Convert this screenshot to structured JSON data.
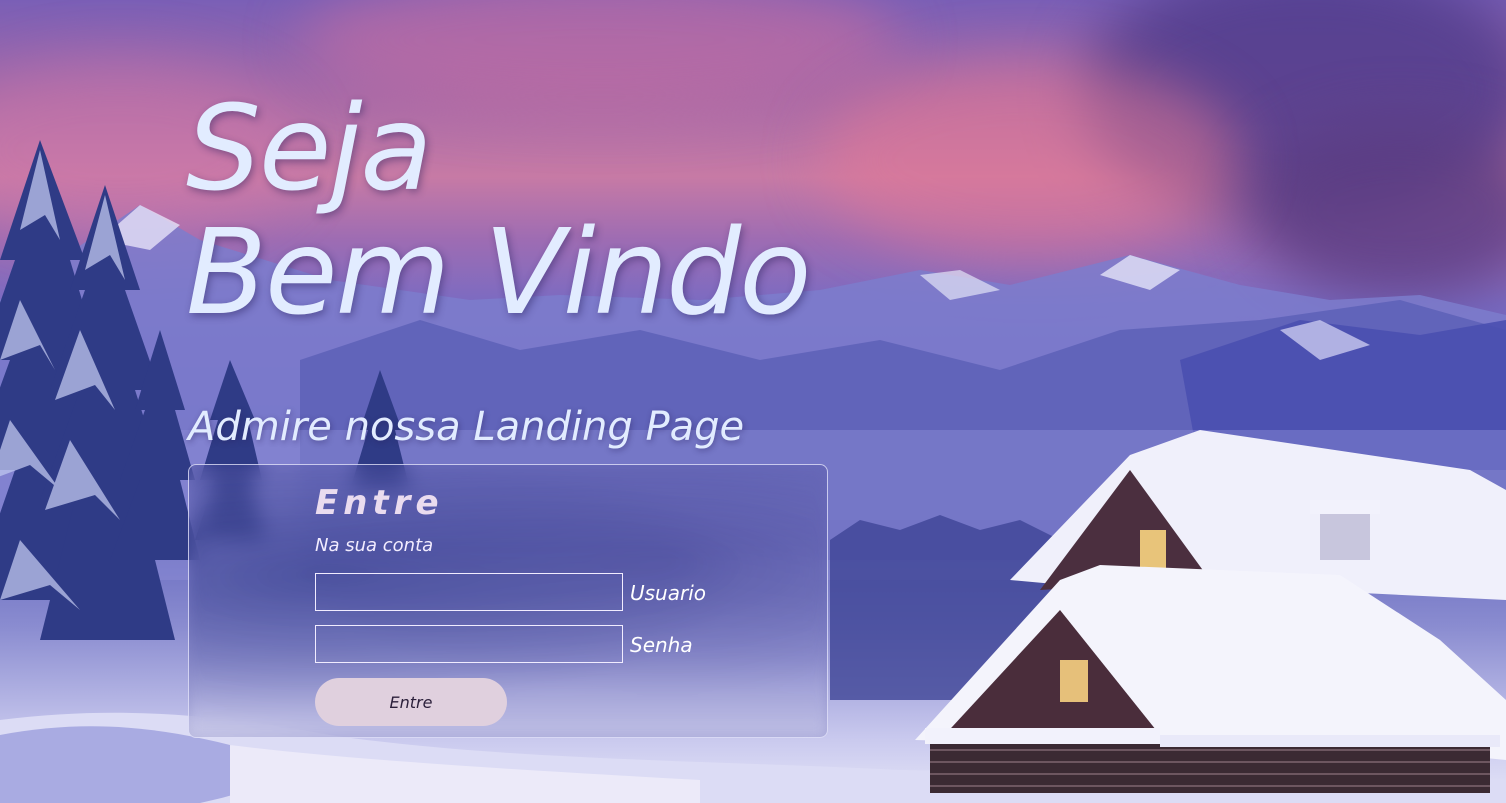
{
  "hero": {
    "line1": "Seja",
    "line2": "Bem Vindo",
    "subtitle": "Admire nossa Landing Page"
  },
  "login": {
    "title": "Entre",
    "subtitle": "Na sua conta",
    "username_label": "Usuario",
    "username_value": "",
    "password_label": "Senha",
    "password_value": "",
    "submit_label": "Entre"
  },
  "background": {
    "scene": "snowy-mountain-cabin",
    "accent_text_color": "#e2ecff",
    "button_color": "#e0d0de"
  }
}
